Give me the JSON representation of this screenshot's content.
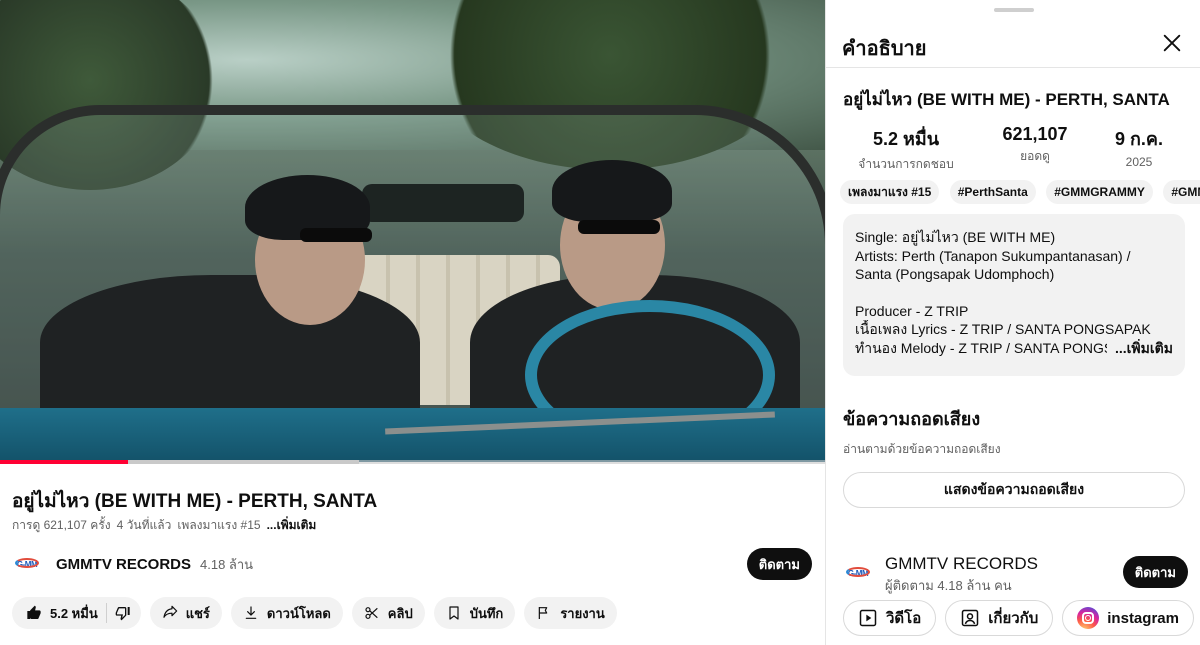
{
  "video": {
    "title": "อยู่ไม่ไหว (BE WITH ME) - PERTH, SANTA",
    "progress_played": 0.155,
    "progress_buffered": 0.435,
    "meta": {
      "views": "การดู 621,107 ครั้ง",
      "age": "4 วันที่แล้ว",
      "trending": "เพลงมาแรง #15",
      "more": "...เพิ่มเติม"
    }
  },
  "channel": {
    "logo_text": "G-MM",
    "name": "GMMTV RECORDS",
    "subs_short": "4.18 ล้าน",
    "subscribe_label": "ติดตาม"
  },
  "actions": {
    "like_count": "5.2 หมื่น",
    "share": "แชร์",
    "download": "ดาวน์โหลด",
    "clip": "คลิป",
    "save": "บันทึก",
    "report": "รายงาน"
  },
  "panel": {
    "title": "คำอธิบาย",
    "video_title": "อยู่ไม่ไหว (BE WITH ME) - PERTH, SANTA",
    "stats": [
      {
        "value": "5.2 หมื่น",
        "label": "จำนวนการกดชอบ"
      },
      {
        "value": "621,107",
        "label": "ยอดดู"
      },
      {
        "value": "9 ก.ค.",
        "label": "2025"
      }
    ],
    "chips": [
      "เพลงมาแรง #15",
      "#PerthSanta",
      "#GMMGRAMMY",
      "#GMMTV"
    ],
    "description": {
      "line1": "Single:  อยู่ไม่ไหว (BE WITH ME)",
      "line2": "Artists: Perth (Tanapon Sukumpantanasan) /",
      "line3": "Santa (Pongsapak Udomphoch)",
      "line4": "Producer - Z TRIP",
      "line5": "เนื้อเพลง Lyrics -  Z TRIP / SANTA PONGSAPAK",
      "line6": "ทำนอง Melody - Z TRIP / SANTA PONGSAPAK",
      "more": "...เพิ่มเติม"
    },
    "transcript": {
      "title": "ข้อความถอดเสียง",
      "subtitle": "อ่านตามด้วยข้อความถอดเสียง",
      "button": "แสดงข้อความถอดเสียง"
    },
    "channel": {
      "name": "GMMTV RECORDS",
      "subs": "ผู้ติดตาม 4.18 ล้าน คน",
      "subscribe_label": "ติดตาม"
    },
    "links": {
      "videos": "วิดีโอ",
      "about": "เกี่ยวกับ",
      "instagram": "instagram"
    }
  },
  "colors": {
    "accent_red": "#ff0033",
    "text_primary": "#0f0f0f",
    "text_secondary": "#606060",
    "chip_bg": "#f2f2f2"
  },
  "icons": [
    "like-icon",
    "dislike-icon",
    "share-icon",
    "download-icon",
    "scissors-icon",
    "bookmark-icon",
    "flag-icon",
    "close-icon",
    "video-icon",
    "about-icon",
    "instagram-icon"
  ]
}
